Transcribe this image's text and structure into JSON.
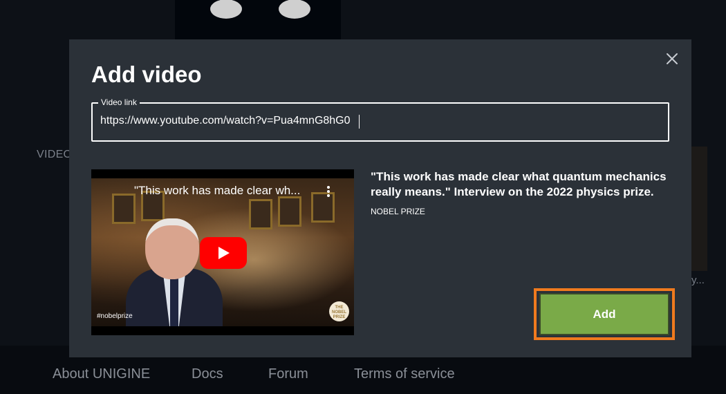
{
  "background": {
    "left_label": "VIDEO",
    "right_text": "y...",
    "footer_links": [
      "About UNIGINE",
      "Docs",
      "Forum",
      "Terms of service"
    ]
  },
  "modal": {
    "title": "Add video",
    "close_icon": "close-icon",
    "video_link": {
      "label": "Video link",
      "value": "https://www.youtube.com/watch?v=Pua4mnG8hG0"
    },
    "preview": {
      "overlay_title": "\"This work has made clear wh...",
      "hashtag": "#nobelprize",
      "badge_text": "THE NOBEL PRIZE",
      "play_icon": "youtube-play-icon",
      "menu_icon": "more-vert-icon"
    },
    "info": {
      "title": "\"This work has made clear what quantum mechanics really means.\" Interview on the 2022 physics prize.",
      "channel": "NOBEL PRIZE"
    },
    "add_button": "Add"
  },
  "colors": {
    "modal_bg": "#2b3138",
    "add_button": "#7aaa48",
    "highlight_outline": "#f07a1e",
    "youtube_red": "#ff0000"
  }
}
